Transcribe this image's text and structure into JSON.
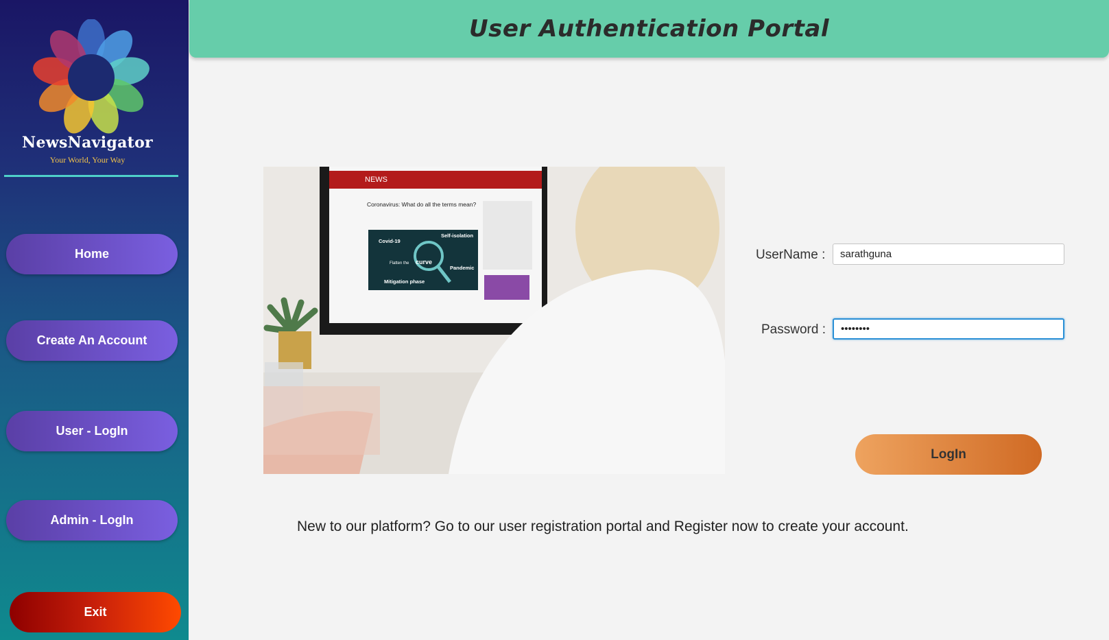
{
  "sidebar": {
    "brand": "NewsNavigator",
    "tagline": "Your World, Your Way",
    "nav": [
      {
        "label": "Home"
      },
      {
        "label": "Create An Account"
      },
      {
        "label": "User - LogIn"
      },
      {
        "label": "Admin - LogIn"
      }
    ],
    "exit_label": "Exit"
  },
  "header": {
    "title": "User Authentication Portal"
  },
  "photo": {
    "screen_brand": "NEWS",
    "screen_headline": "Coronavirus: What do all the terms mean?",
    "infographic": {
      "covid": "Covid-19",
      "self_isolation": "Self-isolation",
      "flatten": "Flatten the",
      "curve": "curve",
      "pandemic": "Pandemic",
      "mitigation": "Mitigation phase"
    }
  },
  "form": {
    "username_label": "UserName :",
    "username_value": "sarathguna",
    "password_label": "Password :",
    "password_value": "sarathgu",
    "login_label": "LogIn"
  },
  "footer": {
    "note": "New to our platform?  Go to our user registration portal and Register now to create your account."
  },
  "colors": {
    "header": "#66cdaa",
    "nav_button": "#6a4fd0",
    "exit_button": "#d02000",
    "login_button": "#e08a45",
    "focus_border": "#2a8fd6"
  }
}
